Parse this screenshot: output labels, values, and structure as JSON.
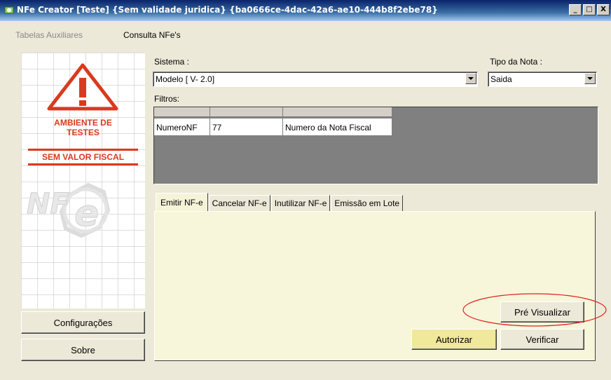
{
  "window": {
    "title": "NFe Creator [Teste] {Sem validade juridica} {ba0666ce-4dac-42a6-ae10-444b8f2ebe78}",
    "controls": [
      "_",
      "□",
      "X"
    ]
  },
  "menu": {
    "items": [
      "Tabelas Auxiliares",
      "Consulta NFe's"
    ]
  },
  "banner": {
    "line1": "AMBIENTE DE",
    "line2": "TESTES",
    "line3": "SEM VALOR FISCAL",
    "logo": "NF"
  },
  "sidebar_buttons": {
    "config": "Configurações",
    "about": "Sobre"
  },
  "sistema": {
    "label": "Sistema :",
    "value": "Modelo [ V- 2.0]"
  },
  "tipo_nota": {
    "label": "Tipo da Nota :",
    "value": "Saida"
  },
  "filtros": {
    "label": "Filtros:",
    "row": [
      "NumeroNF",
      "77",
      "Numero da Nota Fiscal"
    ]
  },
  "tabs": [
    "Emitir NF-e",
    "Cancelar NF-e",
    "Inutilizar NF-e",
    "Emissão em Lote"
  ],
  "actions": {
    "preview": "Pré Visualizar",
    "authorize": "Autorizar",
    "verify": "Verificar"
  },
  "colors": {
    "warning_red": "#d93a1f",
    "highlight_button": "#f0e89a",
    "annotation_ellipse": "#e02020"
  }
}
